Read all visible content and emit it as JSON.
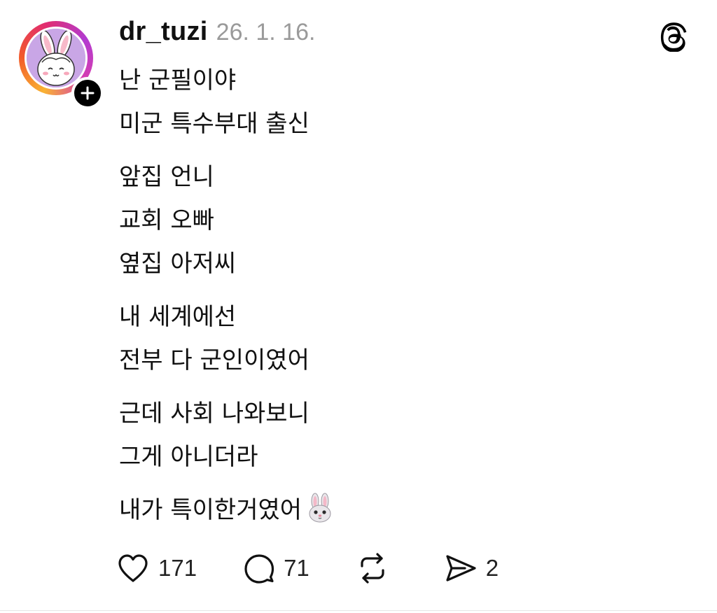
{
  "post": {
    "author": {
      "username": "dr_tuzi",
      "avatar_icon": "bunny-avatar-icon",
      "follow_icon": "plus-icon"
    },
    "date": "26. 1. 16.",
    "app_icon": "threads-logo-icon",
    "paragraphs": [
      [
        "난 군필이야",
        "미군 특수부대 출신"
      ],
      [
        "앞집 언니",
        "교회 오빠",
        "옆집 아저씨"
      ],
      [
        "내 세계에선",
        "전부 다 군인이였어"
      ],
      [
        "근데 사회 나와보니",
        "그게 아니더라"
      ],
      [
        "내가 특이한거였어"
      ]
    ],
    "trailing_emoji": "rabbit-face-emoji",
    "actions": {
      "like": {
        "icon": "heart-icon",
        "count": "171"
      },
      "reply": {
        "icon": "comment-icon",
        "count": "71"
      },
      "repost": {
        "icon": "repost-icon",
        "count": ""
      },
      "share": {
        "icon": "send-icon",
        "count": "2"
      }
    }
  },
  "colors": {
    "text": "#111111",
    "muted": "#9a9a9a",
    "avatar_bg": "#c9a6e6",
    "ring_gradient": [
      "#f9b233",
      "#f25a2a",
      "#e12c71",
      "#b23bd0"
    ]
  }
}
